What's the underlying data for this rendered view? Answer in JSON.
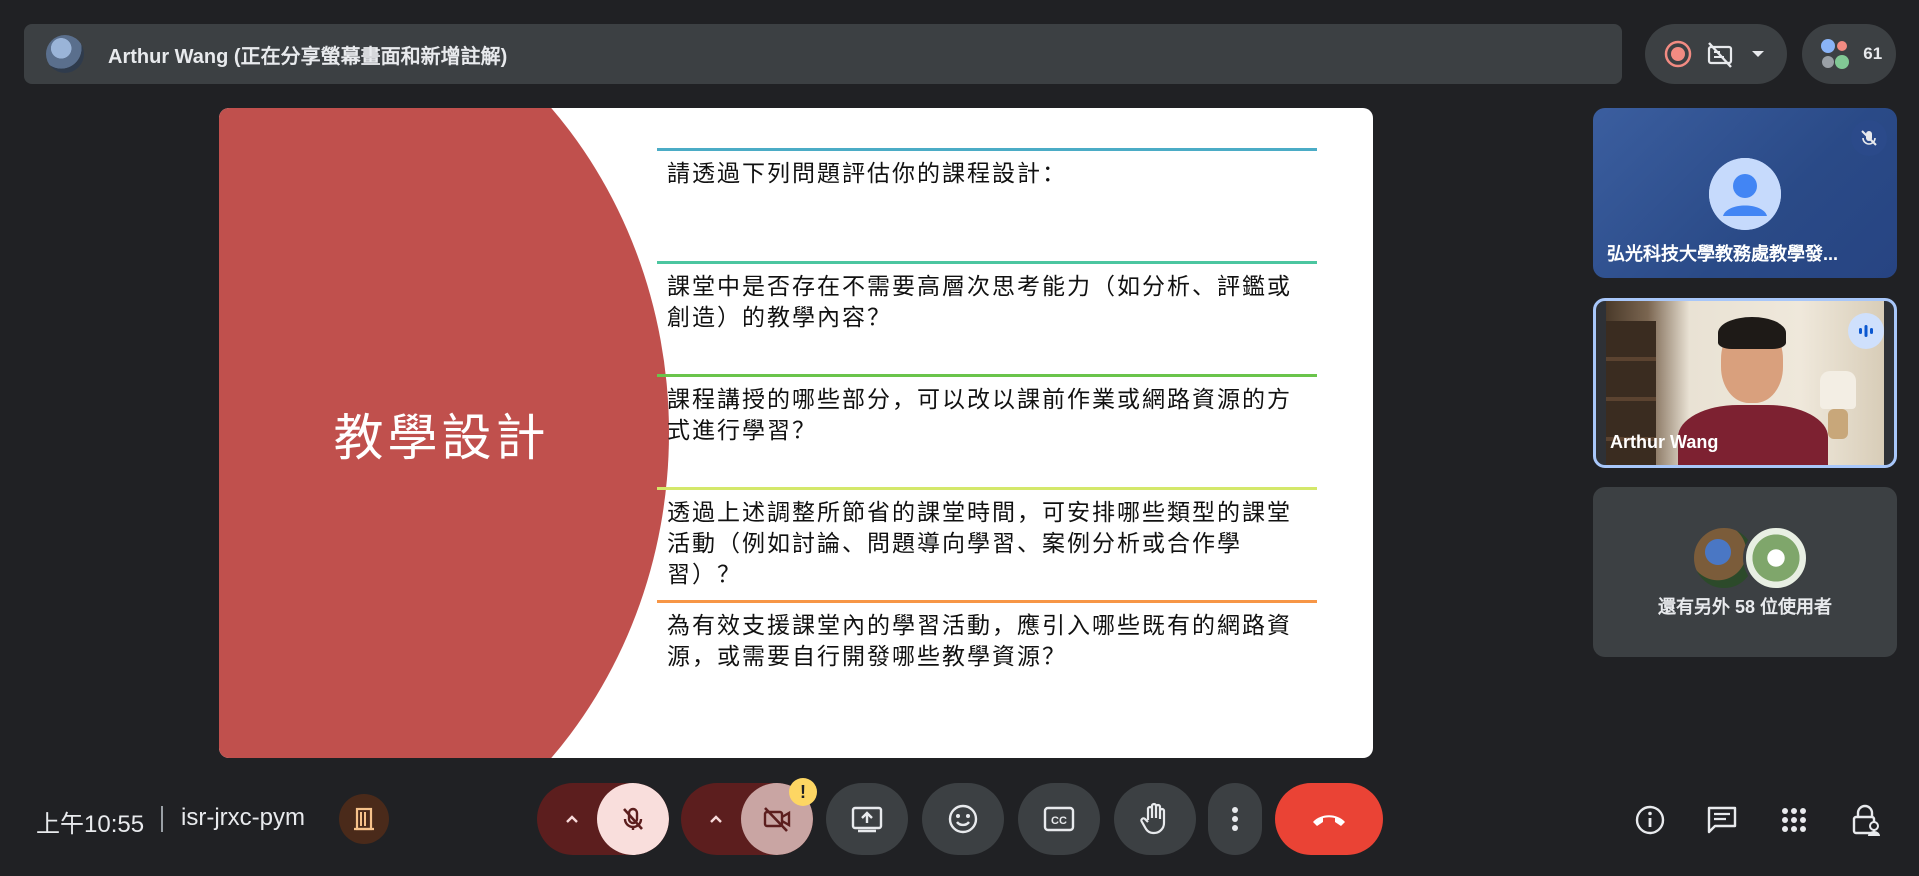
{
  "top_bar": {
    "presenter_title": "Arthur Wang (正在分享螢幕畫面和新增註解)",
    "participant_count": "61"
  },
  "slide": {
    "heading": "教學設計",
    "items": [
      {
        "text": "請透過下列問題評估你的課程設計：",
        "line_color": "#4bacc6"
      },
      {
        "text": "課堂中是否存在不需要高層次思考能力（如分析、評鑑或創造）的教學內容？",
        "line_color": "#4bc6a0"
      },
      {
        "text": "課程講授的哪些部分，可以改以課前作業或網路資源的方式進行學習？",
        "line_color": "#6ac44b"
      },
      {
        "text": "透過上述調整所節省的課堂時間，可安排哪些類型的課堂活動（例如討論、問題導向學習、案例分析或合作學習）？",
        "line_color": "#d4e86a"
      },
      {
        "text": "為有效支援課堂內的學習活動，應引入哪些既有的網路資源，或需要自行開發哪些教學資源？",
        "line_color": "#f79646"
      }
    ]
  },
  "participants": {
    "tile_1_name": "弘光科技大學教務處教學發...",
    "tile_2_name": "Arthur Wang",
    "others_text": "還有另外 58 位使用者"
  },
  "bottom_bar": {
    "time": "上午10:55",
    "meeting_code": "isr-jrxc-pym",
    "warning_badge": "!"
  },
  "colors": {
    "background": "#202124",
    "slide_circle": "#c0504d",
    "end_call": "#ea4335",
    "active_tile_border": "#a8c7fa"
  }
}
